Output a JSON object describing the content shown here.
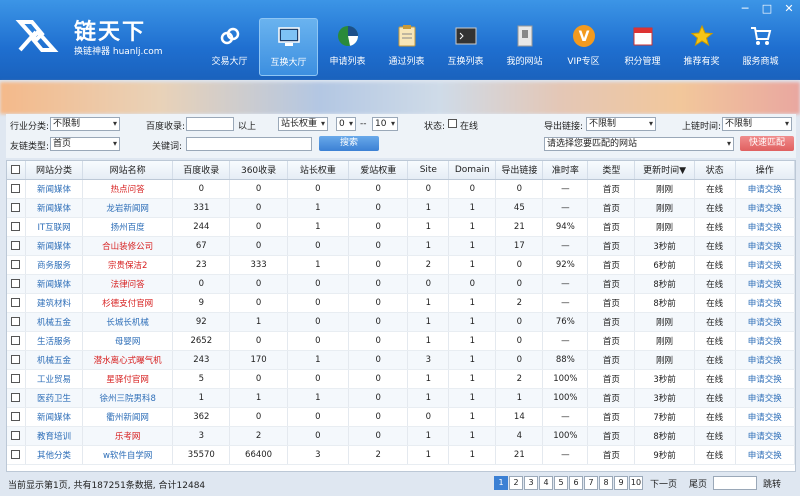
{
  "app": {
    "logo_title": "链天下",
    "logo_subtitle": "换链神器 huanlj.com",
    "window_controls": [
      "─",
      "□",
      "✕"
    ]
  },
  "nav": [
    {
      "label": "交易大厅",
      "icon": "link-icon"
    },
    {
      "label": "互换大厅",
      "icon": "monitor-icon",
      "active": true
    },
    {
      "label": "申请列表",
      "icon": "pie-chart-icon"
    },
    {
      "label": "通过列表",
      "icon": "clipboard-icon"
    },
    {
      "label": "互换列表",
      "icon": "terminal-icon"
    },
    {
      "label": "我的网站",
      "icon": "window-icon"
    },
    {
      "label": "VIP专区",
      "icon": "vip-badge-icon"
    },
    {
      "label": "积分管理",
      "icon": "calendar-icon"
    },
    {
      "label": "推荐有奖",
      "icon": "star-icon"
    },
    {
      "label": "服务商城",
      "icon": "cart-icon"
    }
  ],
  "filters": {
    "industry_label": "行业分类:",
    "industry_value": "不限制",
    "baidu_label": "百度收录:",
    "baidu_value": "",
    "baidu_suffix": "以上",
    "weight_select": "站长权重",
    "weight_from": "0",
    "weight_sep": "--",
    "weight_to": "10",
    "status_label": "状态:",
    "online_label": "在线",
    "export_label": "导出链接:",
    "export_value": "不限制",
    "time_label": "上链时间:",
    "time_value": "不限制",
    "link_type_label": "友链类型:",
    "link_type_value": "首页",
    "keyword_label": "关键词:",
    "keyword_value": "",
    "search_button": "搜索",
    "site_select": "请选择您要匹配的网站",
    "fast_match_button": "快速匹配"
  },
  "table": {
    "headers": [
      "",
      "网站分类",
      "网站名称",
      "百度收录",
      "360收录",
      "站长权重",
      "爱站权重",
      "Site",
      "Domain",
      "导出链接",
      "准时率",
      "类型",
      "更新时间▼",
      "状态",
      "操作"
    ],
    "rows": [
      {
        "cat": "新闻媒体",
        "name": "热点问答",
        "color": "red",
        "baidu": "0",
        "s360": "0",
        "zz": "0",
        "az": "0",
        "site": "0",
        "domain": "0",
        "export": "0",
        "rate": "—",
        "type": "首页",
        "time": "刚刚",
        "status": "在线",
        "op": "申请交换"
      },
      {
        "cat": "新闻媒体",
        "name": "龙岩新闻网",
        "color": "blue",
        "baidu": "331",
        "s360": "0",
        "zz": "1",
        "az": "0",
        "site": "1",
        "domain": "1",
        "export": "45",
        "rate": "—",
        "type": "首页",
        "time": "刚刚",
        "status": "在线",
        "op": "申请交换"
      },
      {
        "cat": "IT互联网",
        "name": "扬州百度",
        "color": "blue",
        "baidu": "244",
        "s360": "0",
        "zz": "1",
        "az": "0",
        "site": "1",
        "domain": "1",
        "export": "21",
        "rate": "94%",
        "type": "首页",
        "time": "刚刚",
        "status": "在线",
        "op": "申请交换"
      },
      {
        "cat": "新闻媒体",
        "name": "合山装修公司",
        "color": "red",
        "baidu": "67",
        "s360": "0",
        "zz": "0",
        "az": "0",
        "site": "1",
        "domain": "1",
        "export": "17",
        "rate": "—",
        "type": "首页",
        "time": "3秒前",
        "status": "在线",
        "op": "申请交换"
      },
      {
        "cat": "商务服务",
        "name": "宗贵保洁2",
        "color": "red",
        "baidu": "23",
        "s360": "333",
        "zz": "1",
        "az": "0",
        "site": "2",
        "domain": "1",
        "export": "0",
        "rate": "92%",
        "type": "首页",
        "time": "6秒前",
        "status": "在线",
        "op": "申请交换"
      },
      {
        "cat": "新闻媒体",
        "name": "法律问答",
        "color": "red",
        "baidu": "0",
        "s360": "0",
        "zz": "0",
        "az": "0",
        "site": "0",
        "domain": "0",
        "export": "0",
        "rate": "—",
        "type": "首页",
        "time": "8秒前",
        "status": "在线",
        "op": "申请交换"
      },
      {
        "cat": "建筑材料",
        "name": "杉德支付官网",
        "color": "red",
        "baidu": "9",
        "s360": "0",
        "zz": "0",
        "az": "0",
        "site": "1",
        "domain": "1",
        "export": "2",
        "rate": "—",
        "type": "首页",
        "time": "8秒前",
        "status": "在线",
        "op": "申请交换"
      },
      {
        "cat": "机械五金",
        "name": "长城长机械",
        "color": "blue",
        "baidu": "92",
        "s360": "1",
        "zz": "0",
        "az": "0",
        "site": "1",
        "domain": "1",
        "export": "0",
        "rate": "76%",
        "type": "首页",
        "time": "刚刚",
        "status": "在线",
        "op": "申请交换"
      },
      {
        "cat": "生活服务",
        "name": "母婴网",
        "color": "blue",
        "baidu": "2652",
        "s360": "0",
        "zz": "0",
        "az": "0",
        "site": "1",
        "domain": "1",
        "export": "0",
        "rate": "—",
        "type": "首页",
        "time": "刚刚",
        "status": "在线",
        "op": "申请交换"
      },
      {
        "cat": "机械五金",
        "name": "潜水离心式曝气机",
        "color": "red",
        "baidu": "243",
        "s360": "170",
        "zz": "1",
        "az": "0",
        "site": "3",
        "domain": "1",
        "export": "0",
        "rate": "88%",
        "type": "首页",
        "time": "刚刚",
        "status": "在线",
        "op": "申请交换"
      },
      {
        "cat": "工业贸易",
        "name": "星驿付官网",
        "color": "red",
        "baidu": "5",
        "s360": "0",
        "zz": "0",
        "az": "0",
        "site": "1",
        "domain": "1",
        "export": "2",
        "rate": "100%",
        "type": "首页",
        "time": "3秒前",
        "status": "在线",
        "op": "申请交换"
      },
      {
        "cat": "医药卫生",
        "name": "徐州三院男科8",
        "color": "blue",
        "baidu": "1",
        "s360": "1",
        "zz": "1",
        "az": "0",
        "site": "1",
        "domain": "1",
        "export": "1",
        "rate": "100%",
        "type": "首页",
        "time": "3秒前",
        "status": "在线",
        "op": "申请交换"
      },
      {
        "cat": "新闻媒体",
        "name": "衢州新闻网",
        "color": "blue",
        "baidu": "362",
        "s360": "0",
        "zz": "0",
        "az": "0",
        "site": "0",
        "domain": "1",
        "export": "14",
        "rate": "—",
        "type": "首页",
        "time": "7秒前",
        "status": "在线",
        "op": "申请交换"
      },
      {
        "cat": "教育培训",
        "name": "乐考网",
        "color": "red",
        "baidu": "3",
        "s360": "2",
        "zz": "0",
        "az": "0",
        "site": "1",
        "domain": "1",
        "export": "4",
        "rate": "100%",
        "type": "首页",
        "time": "8秒前",
        "status": "在线",
        "op": "申请交换"
      },
      {
        "cat": "其他分类",
        "name": "w软件自学网",
        "color": "blue",
        "baidu": "35570",
        "s360": "66400",
        "zz": "3",
        "az": "2",
        "site": "1",
        "domain": "1",
        "export": "21",
        "rate": "—",
        "type": "首页",
        "time": "9秒前",
        "status": "在线",
        "op": "申请交换"
      }
    ]
  },
  "footer": {
    "status_text": "当前显示第1页, 共有187251条数据, 合计12484",
    "pages": [
      "1",
      "2",
      "3",
      "4",
      "5",
      "6",
      "7",
      "8",
      "9",
      "10"
    ],
    "next_label": "下一页",
    "last_label": "尾页",
    "jump_label": "跳转"
  },
  "colors": {
    "header": "#1f6fd0",
    "accent_red": "#d72020",
    "link_blue": "#2f6fb8"
  }
}
